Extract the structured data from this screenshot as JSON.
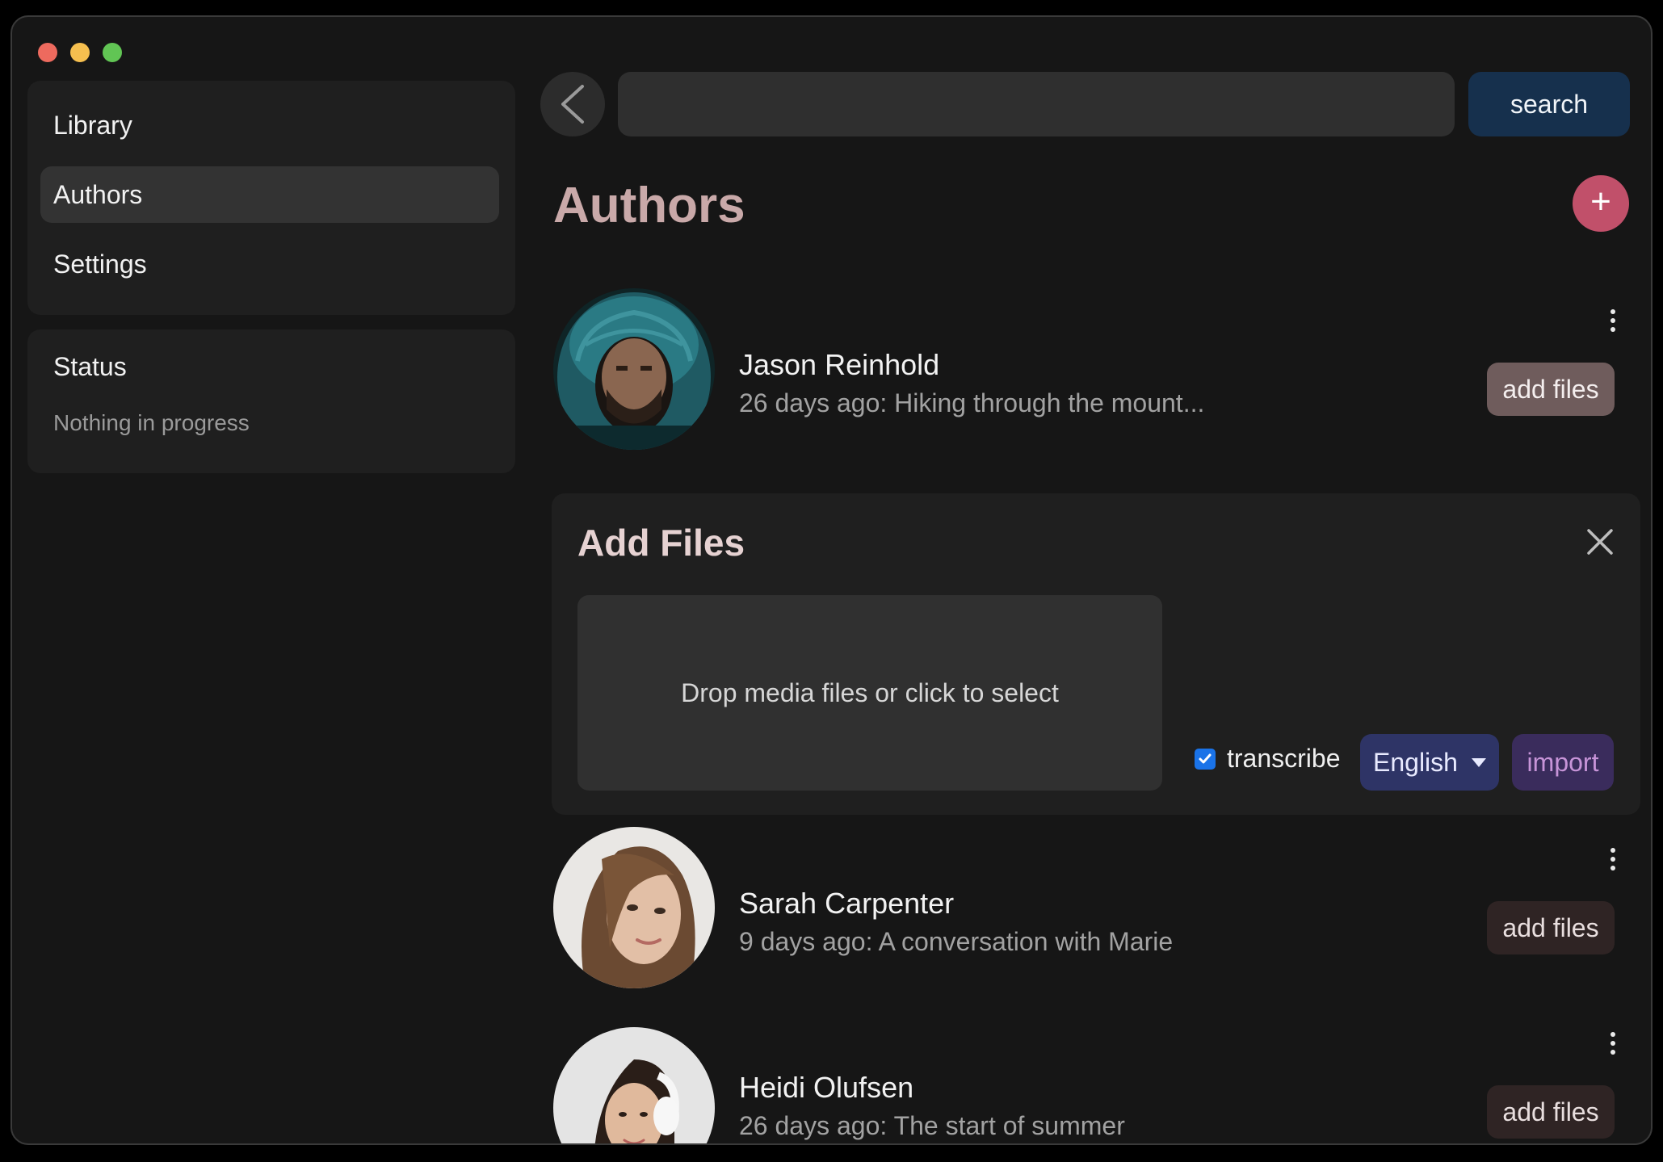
{
  "sidebar": {
    "items": [
      {
        "label": "Library",
        "active": false
      },
      {
        "label": "Authors",
        "active": true
      },
      {
        "label": "Settings",
        "active": false
      }
    ]
  },
  "status": {
    "title": "Status",
    "text": "Nothing in progress"
  },
  "toolbar": {
    "search_value": "",
    "search_button": "search"
  },
  "page": {
    "title": "Authors",
    "add_button": "+"
  },
  "authors": [
    {
      "name": "Jason Reinhold",
      "subtitle": "26 days ago: Hiking through the mount...",
      "button": "add files"
    },
    {
      "name": "Sarah Carpenter",
      "subtitle": "9 days ago: A conversation with Marie",
      "button": "add files"
    },
    {
      "name": "Heidi Olufsen",
      "subtitle": "26 days ago: The start of summer",
      "button": "add files"
    }
  ],
  "add_files": {
    "title": "Add Files",
    "dropzone": "Drop media files or click to select",
    "transcribe_label": "transcribe",
    "transcribe_checked": true,
    "language": "English",
    "import_button": "import"
  },
  "colors": {
    "accent_add": "#c1506a",
    "search_button": "#16304d",
    "language_select": "#2e3466",
    "import_button": "#3a2c5c",
    "title": "#c9a9a9"
  },
  "icons": {
    "back": "chevron-left-icon",
    "close": "close-icon",
    "more": "kebab-icon",
    "plus": "plus-icon"
  }
}
